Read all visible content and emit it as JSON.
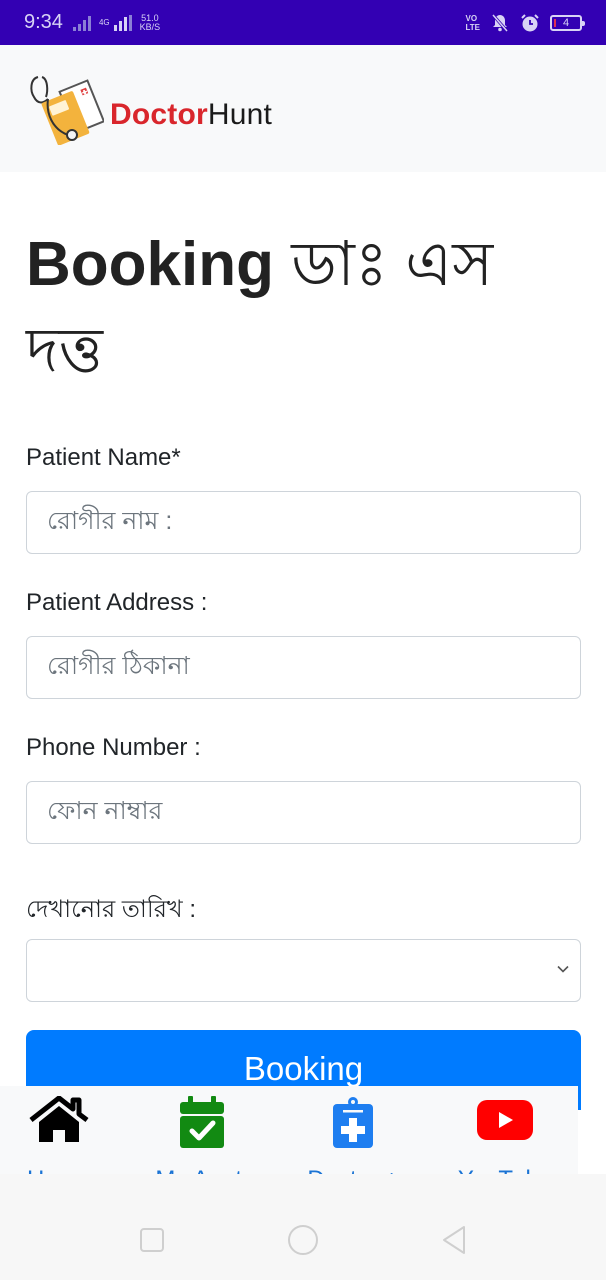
{
  "status_bar": {
    "time": "9:34",
    "network": "4G",
    "speed_value": "51.0",
    "speed_unit": "KB/S",
    "volte_line1": "VO",
    "volte_line2": "LTE",
    "battery_level": "4",
    "background_color": "#3300b3"
  },
  "header": {
    "logo_word1": "Doctor",
    "logo_word2": "Hunt",
    "brand_color": "#d9262c"
  },
  "page": {
    "title_en": "Booking",
    "title_bn": "ডাঃ এস দত্ত"
  },
  "form": {
    "patient_name": {
      "label": "Patient Name*",
      "placeholder": "রোগীর নাম  :",
      "value": ""
    },
    "patient_address": {
      "label": "Patient Address :",
      "placeholder": "রোগীর ঠিকানা",
      "value": ""
    },
    "phone_number": {
      "label": "Phone Number :",
      "placeholder": "ফোন নাম্বার",
      "value": ""
    },
    "appointment_date": {
      "label": "দেখানোর তারিখ :",
      "selected": ""
    },
    "submit_label": "Booking",
    "accent_color": "#007bff"
  },
  "bottom_nav": {
    "items": [
      {
        "label": "Home",
        "icon": "home-icon",
        "color": "#000000"
      },
      {
        "label": "My Appt.",
        "icon": "calendar-check-icon",
        "color": "#128a12"
      },
      {
        "label": "Doctor +",
        "icon": "clipboard-plus-icon",
        "color": "#1e7ef0"
      },
      {
        "label": "YouTube",
        "icon": "youtube-icon",
        "color": "#ff0000"
      }
    ],
    "label_color": "#1a73d4"
  }
}
